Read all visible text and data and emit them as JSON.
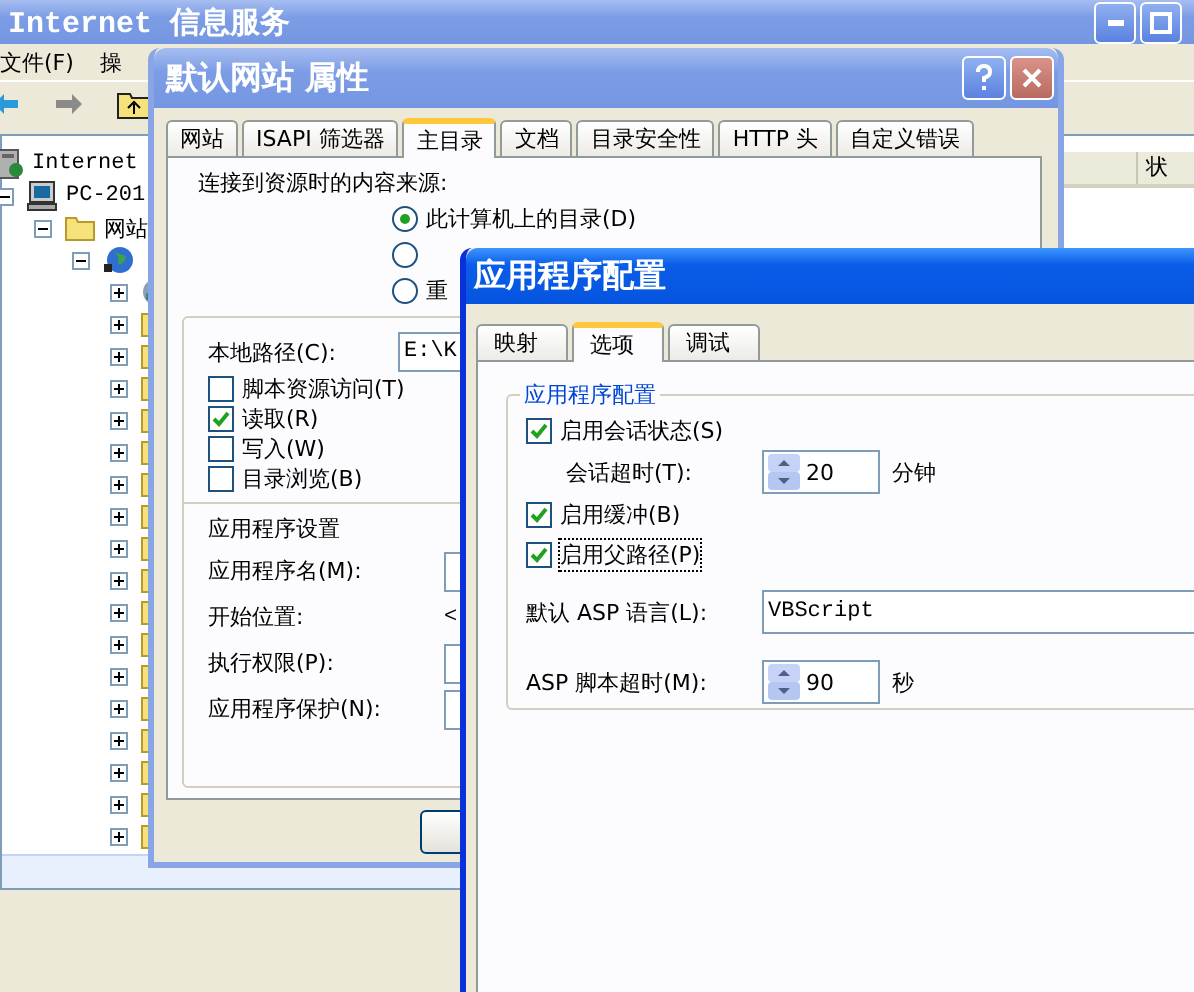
{
  "main_window": {
    "title": "Internet 信息服务",
    "menu": [
      "文件(F)",
      "操"
    ],
    "tree": [
      {
        "label": "Internet",
        "kind": "server",
        "children": [
          {
            "label": "PC-201",
            "kind": "computer",
            "expanded": true,
            "children": [
              {
                "label": "网站",
                "kind": "folder",
                "expanded": true,
                "children": [
                  {
                    "kind": "globe",
                    "expanded": true,
                    "children": [
                      {
                        "kind": "app",
                        "expanded": false
                      },
                      {
                        "kind": "folder",
                        "expanded": false
                      },
                      {
                        "kind": "folder",
                        "expanded": false
                      },
                      {
                        "kind": "folder",
                        "expanded": false
                      },
                      {
                        "kind": "folder",
                        "expanded": false
                      },
                      {
                        "kind": "folder",
                        "expanded": false
                      },
                      {
                        "kind": "folder",
                        "expanded": false
                      },
                      {
                        "kind": "folder",
                        "expanded": false
                      },
                      {
                        "kind": "folder",
                        "expanded": false
                      },
                      {
                        "kind": "folder",
                        "expanded": false
                      },
                      {
                        "kind": "folder",
                        "expanded": false
                      },
                      {
                        "kind": "folder",
                        "expanded": false
                      },
                      {
                        "kind": "folder",
                        "expanded": false
                      },
                      {
                        "kind": "folder",
                        "expanded": false
                      },
                      {
                        "kind": "folder",
                        "expanded": false
                      },
                      {
                        "kind": "folder",
                        "expanded": false
                      },
                      {
                        "kind": "folder",
                        "expanded": false
                      },
                      {
                        "kind": "folder",
                        "expanded": false
                      }
                    ]
                  }
                ]
              }
            ]
          }
        ]
      }
    ],
    "columns": [
      "状"
    ]
  },
  "properties_dialog": {
    "title": "默认网站 属性",
    "tabs": [
      {
        "label": "网站",
        "selected": false
      },
      {
        "label": "ISAPI 筛选器",
        "selected": false
      },
      {
        "label": "主目录",
        "selected": true
      },
      {
        "label": "文档",
        "selected": false
      },
      {
        "label": "目录安全性",
        "selected": false
      },
      {
        "label": "HTTP 头",
        "selected": false
      },
      {
        "label": "自定义错误",
        "selected": false
      }
    ],
    "source_label": "连接到资源时的内容来源:",
    "source_options": [
      {
        "label": "此计算机上的目录(D)",
        "selected": true
      },
      {
        "selected": false
      },
      {
        "label": "重",
        "selected": false
      }
    ],
    "local_path": {
      "label": "本地路径(C):",
      "value": "E:\\K"
    },
    "permissions": [
      {
        "label": "脚本资源访问(T)",
        "checked": false
      },
      {
        "label": "读取(R)",
        "checked": true
      },
      {
        "label": "写入(W)",
        "checked": false
      },
      {
        "label": "目录浏览(B)",
        "checked": false
      }
    ],
    "app_settings": {
      "title": "应用程序设置",
      "fields": [
        {
          "label": "应用程序名(M):",
          "kind": "text"
        },
        {
          "label": "开始位置:",
          "value": "<",
          "kind": "plain"
        },
        {
          "label": "执行权限(P):",
          "kind": "dropdown"
        },
        {
          "label": "应用程序保护(N):",
          "kind": "dropdown"
        }
      ]
    }
  },
  "app_config_dialog": {
    "title": "应用程序配置",
    "tabs": [
      {
        "label": "映射",
        "selected": false
      },
      {
        "label": "选项",
        "selected": true
      },
      {
        "label": "调试",
        "selected": false
      }
    ],
    "group_title": "应用程序配置",
    "options": [
      {
        "kind": "checkbox",
        "label": "启用会话状态(S)",
        "checked": true,
        "focused": false
      },
      {
        "kind": "spinner",
        "label": "会话超时(T):",
        "value": "20",
        "unit": "分钟"
      },
      {
        "kind": "checkbox",
        "label": "启用缓冲(B)",
        "checked": true,
        "focused": false
      },
      {
        "kind": "checkbox",
        "label": "启用父路径(P)",
        "checked": true,
        "focused": true
      }
    ],
    "language": {
      "label": "默认 ASP 语言(L):",
      "value": "VBScript"
    },
    "script_timeout": {
      "label": "ASP 脚本超时(M):",
      "value": "90",
      "unit": "秒"
    }
  }
}
